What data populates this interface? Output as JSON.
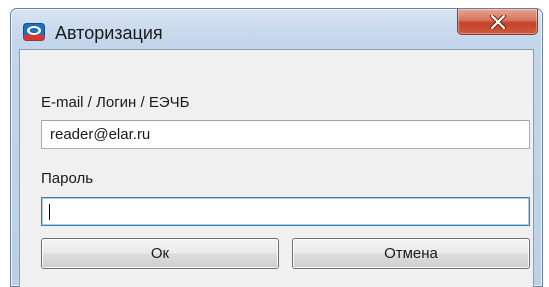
{
  "window": {
    "title": "Авторизация",
    "icon": "app-logo-icon",
    "close_icon": "close-icon"
  },
  "form": {
    "login_label": "E-mail / Логин / ЕЭЧБ",
    "login_value": "reader@elar.ru",
    "password_label": "Пароль",
    "password_value": ""
  },
  "buttons": {
    "ok_label": "Ок",
    "cancel_label": "Отмена"
  },
  "colors": {
    "close_button": "#c4432a",
    "focus_border": "#3c7fb1",
    "window_frame": "#c4d6eb"
  }
}
